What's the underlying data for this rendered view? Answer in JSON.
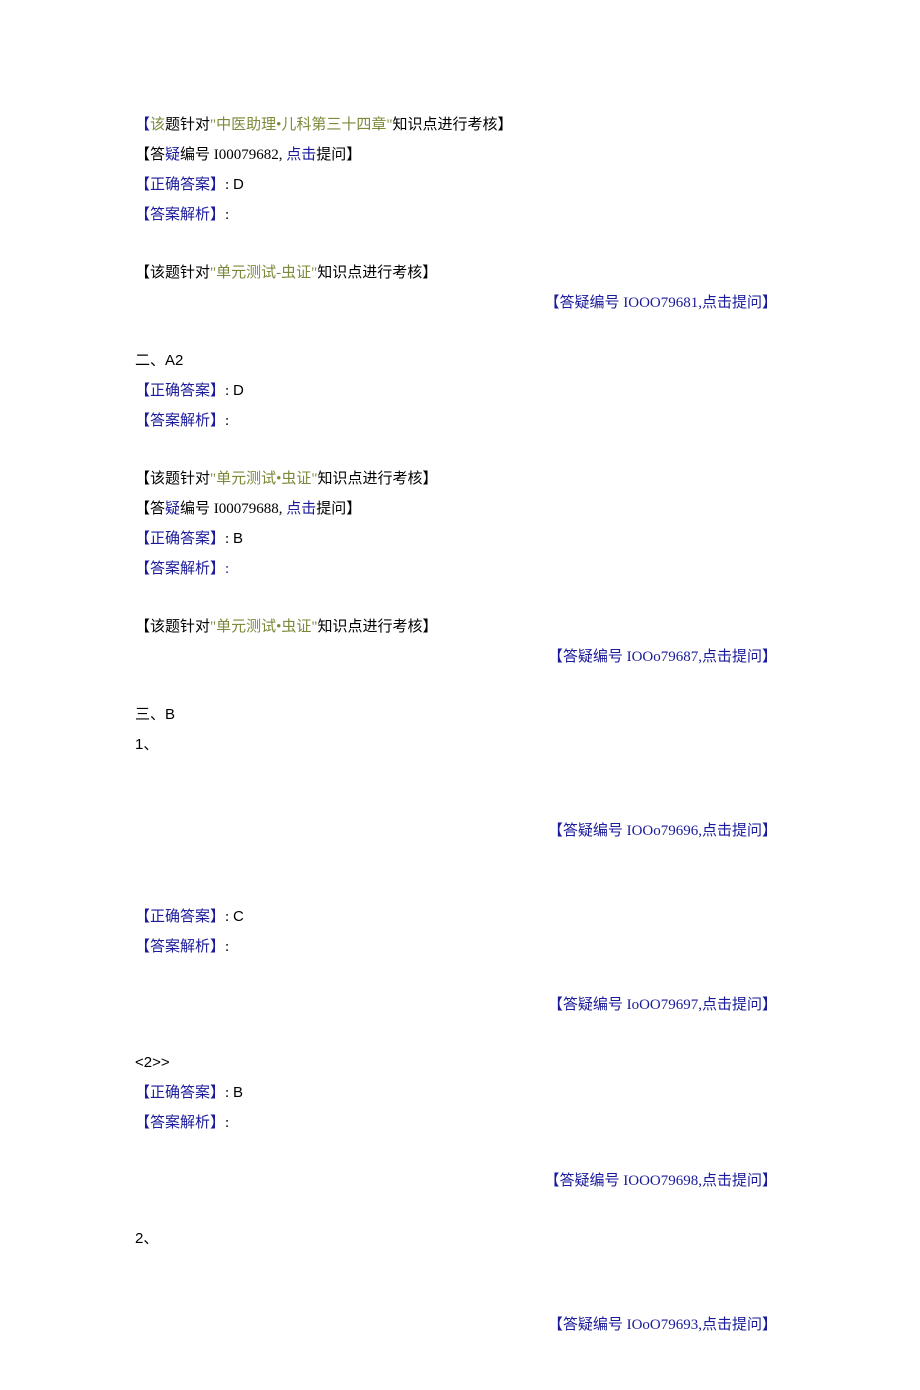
{
  "lines": [
    {
      "align": "left",
      "parts": [
        {
          "color": "navy",
          "text": "【"
        },
        {
          "color": "olive",
          "text": "该"
        },
        {
          "color": "black",
          "text": "题针对"
        },
        {
          "color": "olive",
          "text": "\"中医助理•儿科第三十四章\""
        },
        {
          "color": "black",
          "text": "知识点进行考核】"
        }
      ]
    },
    {
      "align": "left",
      "parts": [
        {
          "color": "black",
          "text": "【答"
        },
        {
          "color": "navy",
          "text": "疑"
        },
        {
          "color": "black",
          "text": "编号 I00079682, "
        },
        {
          "color": "navy",
          "text": "点击"
        },
        {
          "color": "black",
          "text": "提问】"
        }
      ]
    },
    {
      "align": "left",
      "parts": [
        {
          "color": "navy",
          "text": "【正确答案】"
        },
        {
          "color": "black",
          "text": ": "
        },
        {
          "color": "black",
          "text": "D",
          "arial": true
        }
      ]
    },
    {
      "align": "left",
      "parts": [
        {
          "color": "navy",
          "text": "【答案解析】"
        },
        {
          "color": "black",
          "text": ":"
        }
      ]
    },
    {
      "spacer": true
    },
    {
      "align": "left",
      "parts": [
        {
          "color": "black",
          "text": "【该题针对"
        },
        {
          "color": "olive",
          "text": "\"单元测试-虫证\""
        },
        {
          "color": "black",
          "text": "知识点进行考核】"
        }
      ]
    },
    {
      "align": "right",
      "parts": [
        {
          "color": "navy",
          "text": "【答疑编号 IOOO79681,点击提问】"
        }
      ]
    },
    {
      "spacer": true
    },
    {
      "align": "left",
      "parts": [
        {
          "color": "black",
          "text": "二、"
        },
        {
          "color": "black",
          "text": "A2",
          "arial": true
        }
      ]
    },
    {
      "align": "left",
      "parts": [
        {
          "color": "navy",
          "text": "【正确答案】"
        },
        {
          "color": "black",
          "text": ": "
        },
        {
          "color": "black",
          "text": "D",
          "arial": true
        }
      ]
    },
    {
      "align": "left",
      "parts": [
        {
          "color": "navy",
          "text": "【答案解析】"
        },
        {
          "color": "black",
          "text": ":"
        }
      ]
    },
    {
      "spacer": true
    },
    {
      "align": "left",
      "parts": [
        {
          "color": "black",
          "text": "【该题针对"
        },
        {
          "color": "olive",
          "text": "\"单元测试•虫证\""
        },
        {
          "color": "black",
          "text": "知识点进行考核】"
        }
      ]
    },
    {
      "align": "left",
      "parts": [
        {
          "color": "black",
          "text": "【答"
        },
        {
          "color": "navy",
          "text": "疑"
        },
        {
          "color": "black",
          "text": "编号 I00079688, "
        },
        {
          "color": "navy",
          "text": "点击"
        },
        {
          "color": "black",
          "text": "提问】"
        }
      ]
    },
    {
      "align": "left",
      "parts": [
        {
          "color": "navy",
          "text": "【正确答案】"
        },
        {
          "color": "black",
          "text": ": "
        },
        {
          "color": "black",
          "text": "B",
          "arial": true
        }
      ]
    },
    {
      "align": "left",
      "parts": [
        {
          "color": "navy",
          "text": "【答案解析】:"
        }
      ]
    },
    {
      "spacer": true
    },
    {
      "align": "left",
      "parts": [
        {
          "color": "black",
          "text": "【该题针对"
        },
        {
          "color": "olive",
          "text": "\"单元测试•虫证\""
        },
        {
          "color": "black",
          "text": "知识点进行考核】"
        }
      ]
    },
    {
      "align": "right",
      "parts": [
        {
          "color": "navy",
          "text": "【答疑编号 IOOo79687,点击提问】"
        }
      ]
    },
    {
      "spacer": true
    },
    {
      "align": "left",
      "parts": [
        {
          "color": "black",
          "text": "三、"
        },
        {
          "color": "black",
          "text": "B",
          "arial": true
        }
      ]
    },
    {
      "align": "left",
      "parts": [
        {
          "color": "black",
          "text": "1",
          "arial": true
        },
        {
          "color": "black",
          "text": "、"
        }
      ]
    },
    {
      "spacer": true
    },
    {
      "spacer": true
    },
    {
      "align": "right",
      "parts": [
        {
          "color": "navy",
          "text": "【答疑编号 IOOo79696,点击提问】"
        }
      ]
    },
    {
      "spacer": true
    },
    {
      "spacer": true
    },
    {
      "align": "left",
      "parts": [
        {
          "color": "navy",
          "text": "【正确答案】"
        },
        {
          "color": "black",
          "text": ": "
        },
        {
          "color": "black",
          "text": "C",
          "arial": true
        }
      ]
    },
    {
      "align": "left",
      "parts": [
        {
          "color": "navy",
          "text": "【答案解析】"
        },
        {
          "color": "black",
          "text": ":"
        }
      ]
    },
    {
      "spacer": true
    },
    {
      "align": "right",
      "parts": [
        {
          "color": "navy",
          "text": "【答疑编号 IoOO79697,点击提问】"
        }
      ]
    },
    {
      "spacer": true
    },
    {
      "align": "left",
      "parts": [
        {
          "color": "black",
          "text": "<2>>",
          "arial": true
        }
      ]
    },
    {
      "align": "left",
      "parts": [
        {
          "color": "navy",
          "text": "【正确答案】"
        },
        {
          "color": "black",
          "text": ": "
        },
        {
          "color": "black",
          "text": "B",
          "arial": true
        }
      ]
    },
    {
      "align": "left",
      "parts": [
        {
          "color": "navy",
          "text": "【答案解析】"
        },
        {
          "color": "black",
          "text": ":"
        }
      ]
    },
    {
      "spacer": true
    },
    {
      "align": "right",
      "parts": [
        {
          "color": "navy",
          "text": "【答疑编号 IOOO79698,点击提问】"
        }
      ]
    },
    {
      "spacer": true
    },
    {
      "align": "left",
      "parts": [
        {
          "color": "black",
          "text": "2",
          "arial": true
        },
        {
          "color": "black",
          "text": "、"
        }
      ]
    },
    {
      "spacer": true
    },
    {
      "spacer": true
    },
    {
      "align": "right",
      "parts": [
        {
          "color": "navy",
          "text": "【答疑编号 IOoO79693,点击提问】"
        }
      ]
    }
  ]
}
